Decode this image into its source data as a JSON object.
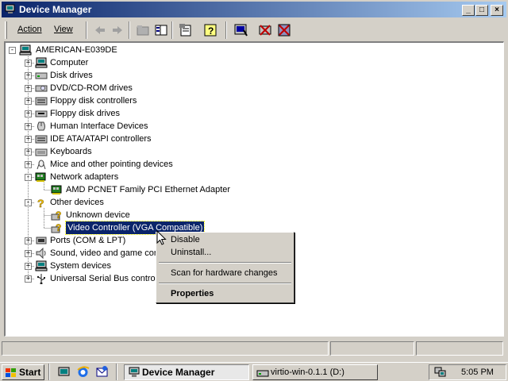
{
  "window": {
    "title": "Device Manager"
  },
  "toolbar": {
    "action_label": "Action",
    "view_label": "View"
  },
  "tree": {
    "root": "AMERICAN-E039DE",
    "items": [
      {
        "label": "Computer",
        "icon": "computer-icon",
        "expander": "+"
      },
      {
        "label": "Disk drives",
        "icon": "disk-drive-icon",
        "expander": "+"
      },
      {
        "label": "DVD/CD-ROM drives",
        "icon": "cdrom-icon",
        "expander": "+"
      },
      {
        "label": "Floppy disk controllers",
        "icon": "controller-icon",
        "expander": "+"
      },
      {
        "label": "Floppy disk drives",
        "icon": "floppy-icon",
        "expander": "+"
      },
      {
        "label": "Human Interface Devices",
        "icon": "hid-icon",
        "expander": "+"
      },
      {
        "label": "IDE ATA/ATAPI controllers",
        "icon": "controller-icon",
        "expander": "+"
      },
      {
        "label": "Keyboards",
        "icon": "keyboard-icon",
        "expander": "+"
      },
      {
        "label": "Mice and other pointing devices",
        "icon": "mouse-icon",
        "expander": "+"
      },
      {
        "label": "Network adapters",
        "icon": "network-card-icon",
        "expander": "-"
      },
      {
        "label": "AMD PCNET Family PCI Ethernet Adapter",
        "icon": "network-card-icon",
        "child": true
      },
      {
        "label": "Other devices",
        "icon": "question-icon",
        "expander": "-"
      },
      {
        "label": "Unknown device",
        "icon": "unknown-device-icon",
        "child": true
      },
      {
        "label": "Video Controller (VGA Compatible)",
        "icon": "unknown-device-icon",
        "child": true,
        "selected": true
      },
      {
        "label": "Ports (COM & LPT)",
        "icon": "port-icon",
        "expander": "+"
      },
      {
        "label": "Sound, video and game controllers",
        "icon": "sound-icon",
        "expander": "+"
      },
      {
        "label": "System devices",
        "icon": "computer-icon",
        "expander": "+"
      },
      {
        "label": "Universal Serial Bus controllers",
        "icon": "usb-icon",
        "expander": "+"
      }
    ]
  },
  "context_menu": {
    "disable": "Disable",
    "uninstall": "Uninstall...",
    "scan": "Scan for hardware changes",
    "properties": "Properties"
  },
  "taskbar": {
    "start_label": "Start",
    "tasks": [
      {
        "label": "Device Manager",
        "active": true
      },
      {
        "label": "virtio-win-0.1.1 (D:)",
        "active": false
      }
    ],
    "clock": "5:05 PM"
  },
  "colors": {
    "title_start": "#0a246a",
    "title_end": "#a6caf0",
    "selection": "#0a246a",
    "face": "#d4d0c8"
  }
}
